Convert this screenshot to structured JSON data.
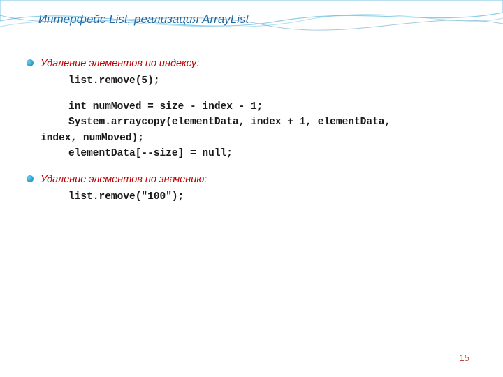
{
  "title": "Интерфейс List, реализация ArrayList",
  "section1": {
    "heading": "Удаление элементов по индексу:",
    "code1": "list.remove(5);",
    "code2": "int numMoved = size - index - 1;",
    "code3a": "System.arraycopy(elementData, index + 1, elementData,",
    "code3b": "index, numMoved);",
    "code4": "elementData[--size] = null;"
  },
  "section2": {
    "heading": " Удаление элементов по значению:",
    "code1": "list.remove(\"100\");"
  },
  "page_number": "15"
}
